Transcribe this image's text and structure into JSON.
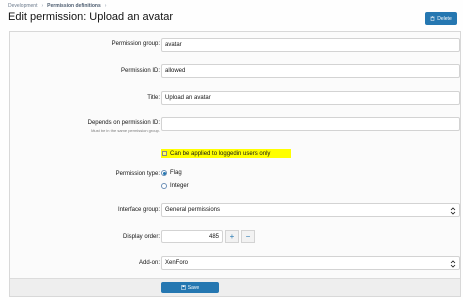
{
  "breadcrumb": {
    "items": [
      "Development",
      "Permission definitions"
    ]
  },
  "page_title": "Edit permission: Upload an avatar",
  "header": {
    "delete_label": "Delete"
  },
  "form": {
    "permission_group": {
      "label": "Permission group:",
      "value": "avatar"
    },
    "permission_id": {
      "label": "Permission ID:",
      "value": "allowed"
    },
    "title": {
      "label": "Title:",
      "value": "Upload an avatar"
    },
    "depends_on": {
      "label": "Depends on permission ID:",
      "sublabel": "Must be in the same permission group.",
      "value": ""
    },
    "logged_in_checkbox": {
      "label": "Can be applied to loggedin users only",
      "checked": false
    },
    "permission_type": {
      "label": "Permission type:",
      "options": [
        {
          "label": "Flag",
          "checked": true
        },
        {
          "label": "Integer",
          "checked": false
        }
      ]
    },
    "interface_group": {
      "label": "Interface group:",
      "value": "General permissions"
    },
    "display_order": {
      "label": "Display order:",
      "value": "485",
      "plus": "+",
      "minus": "−"
    },
    "addon": {
      "label": "Add-on:",
      "value": "XenForo"
    }
  },
  "footer": {
    "save_label": "Save"
  },
  "colors": {
    "accent": "#2577b1",
    "highlight": "#ffff00"
  }
}
